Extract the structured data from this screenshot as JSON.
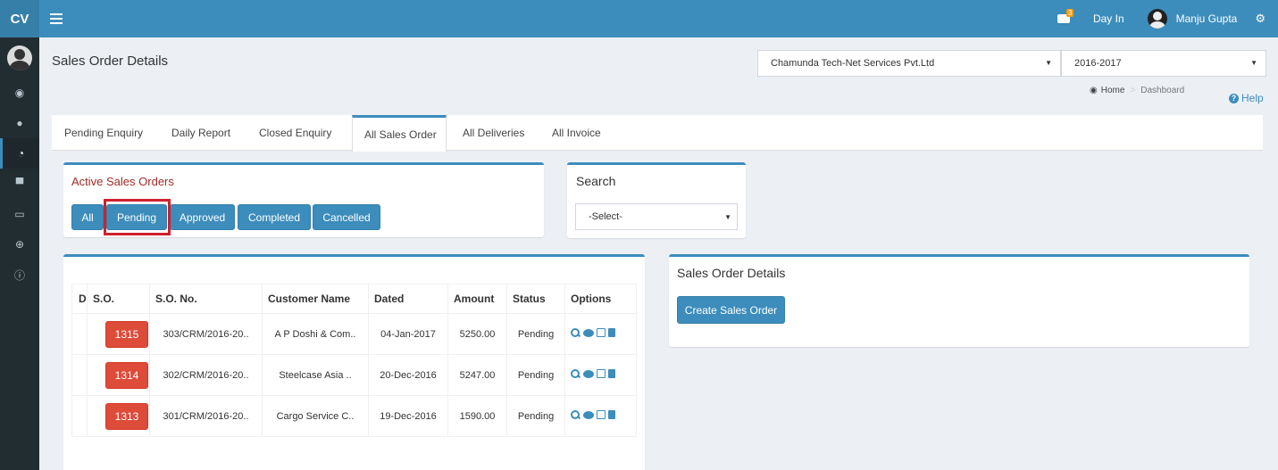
{
  "app": {
    "logo": "CV"
  },
  "header": {
    "notification_count": "3",
    "day_in": "Day In",
    "user_name": "Manju Gupta"
  },
  "page": {
    "title": "Sales Order Details"
  },
  "selectors": {
    "company": "Chamunda Tech-Net Services Pvt.Ltd",
    "year": "2016-2017"
  },
  "breadcrumb": {
    "home": "Home",
    "current": "Dashboard"
  },
  "help": "Help",
  "tabs": [
    {
      "label": "Pending Enquiry"
    },
    {
      "label": "Daily Report"
    },
    {
      "label": "Closed Enquiry"
    },
    {
      "label": "All Sales Order"
    },
    {
      "label": "All Deliveries"
    },
    {
      "label": "All Invoice"
    }
  ],
  "active_orders": {
    "title": "Active Sales Orders",
    "filters": [
      "All",
      "Pending",
      "Approved",
      "Completed",
      "Cancelled"
    ],
    "selected": "Pending"
  },
  "search": {
    "title": "Search",
    "select_value": "-Select-"
  },
  "table": {
    "columns": [
      "D",
      "S.O.",
      "S.O. No.",
      "Customer Name",
      "Dated",
      "Amount",
      "Status",
      "Options"
    ],
    "rows": [
      {
        "so": "1315",
        "so_no": "303/CRM/2016-20..",
        "customer": "A P Doshi & Com..",
        "dated": "04-Jan-2017",
        "amount": "5250.00",
        "status": "Pending"
      },
      {
        "so": "1314",
        "so_no": "302/CRM/2016-20..",
        "customer": "Steelcase Asia ..",
        "dated": "20-Dec-2016",
        "amount": "5247.00",
        "status": "Pending"
      },
      {
        "so": "1313",
        "so_no": "301/CRM/2016-20..",
        "customer": "Cargo Service C..",
        "dated": "19-Dec-2016",
        "amount": "1590.00",
        "status": "Pending"
      }
    ]
  },
  "details_panel": {
    "title": "Sales Order Details",
    "create_button": "Create Sales Order"
  },
  "colors": {
    "primary": "#3c8dbc",
    "danger": "#dd4b39",
    "sidebar": "#222d32",
    "highlight": "#d0202e"
  }
}
